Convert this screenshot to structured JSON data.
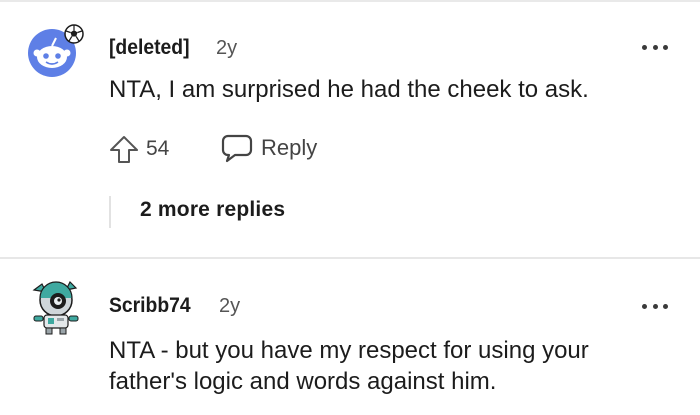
{
  "comments": [
    {
      "avatar_icon": "snoo-avatar-icon",
      "username": "[deleted]",
      "age": "2y",
      "text": "NTA, I am surprised he had the cheek to ask.",
      "upvotes": "54",
      "reply_label": "Reply",
      "more_replies_label": "2 more replies"
    },
    {
      "avatar_icon": "robot-avatar-icon",
      "username": "Scribb74",
      "age": "2y",
      "text": "NTA - but you have my respect for using your father's logic and words against him."
    }
  ],
  "icons": {
    "upvote": "upvote-arrow-icon",
    "reply": "speech-bubble-icon",
    "more": "more-options-icon"
  },
  "colors": {
    "text": "#1c1c1c",
    "meta": "#555555",
    "avatar_blue": "#5e7fe6",
    "robot_teal": "#3fa9a0"
  }
}
